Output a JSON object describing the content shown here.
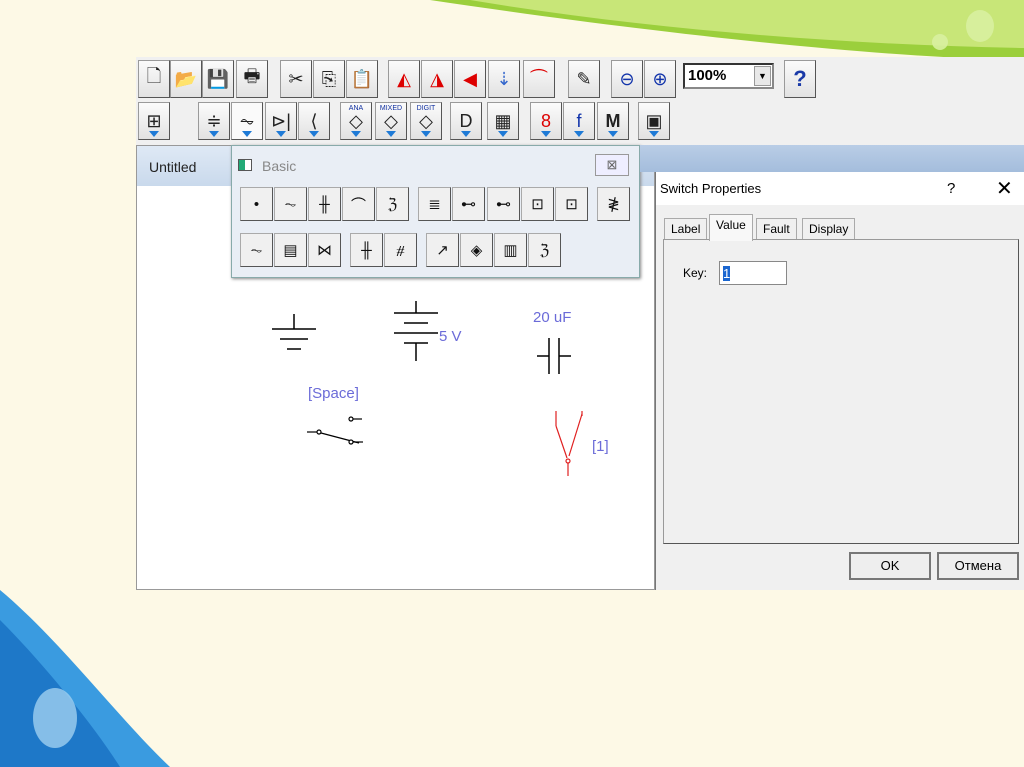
{
  "toolbar": {
    "zoom_value": "100%",
    "help_label": "?",
    "row2_labels": {
      "analog": "ANA",
      "mixed": "MIXED",
      "digital": "DIGIT",
      "multimeter": "M"
    }
  },
  "document": {
    "title": "Untitled"
  },
  "palette": {
    "title": "Basic",
    "close": "⊠"
  },
  "circuit": {
    "battery_value": "5 V",
    "capacitor_value": "20 uF",
    "switch_key_space": "[Space]",
    "switch_key_1": "[1]"
  },
  "dialog": {
    "title": "Switch Properties",
    "help": "?",
    "close": "✕",
    "tabs": [
      "Label",
      "Value",
      "Fault",
      "Display"
    ],
    "active_tab": "Value",
    "key_label": "Key:",
    "key_value": "1",
    "ok": "OK",
    "cancel": "Отмена"
  },
  "colors": {
    "accent_green": "#8cc63f",
    "accent_blue": "#3a9be0",
    "selected_switch": "#e02020"
  }
}
